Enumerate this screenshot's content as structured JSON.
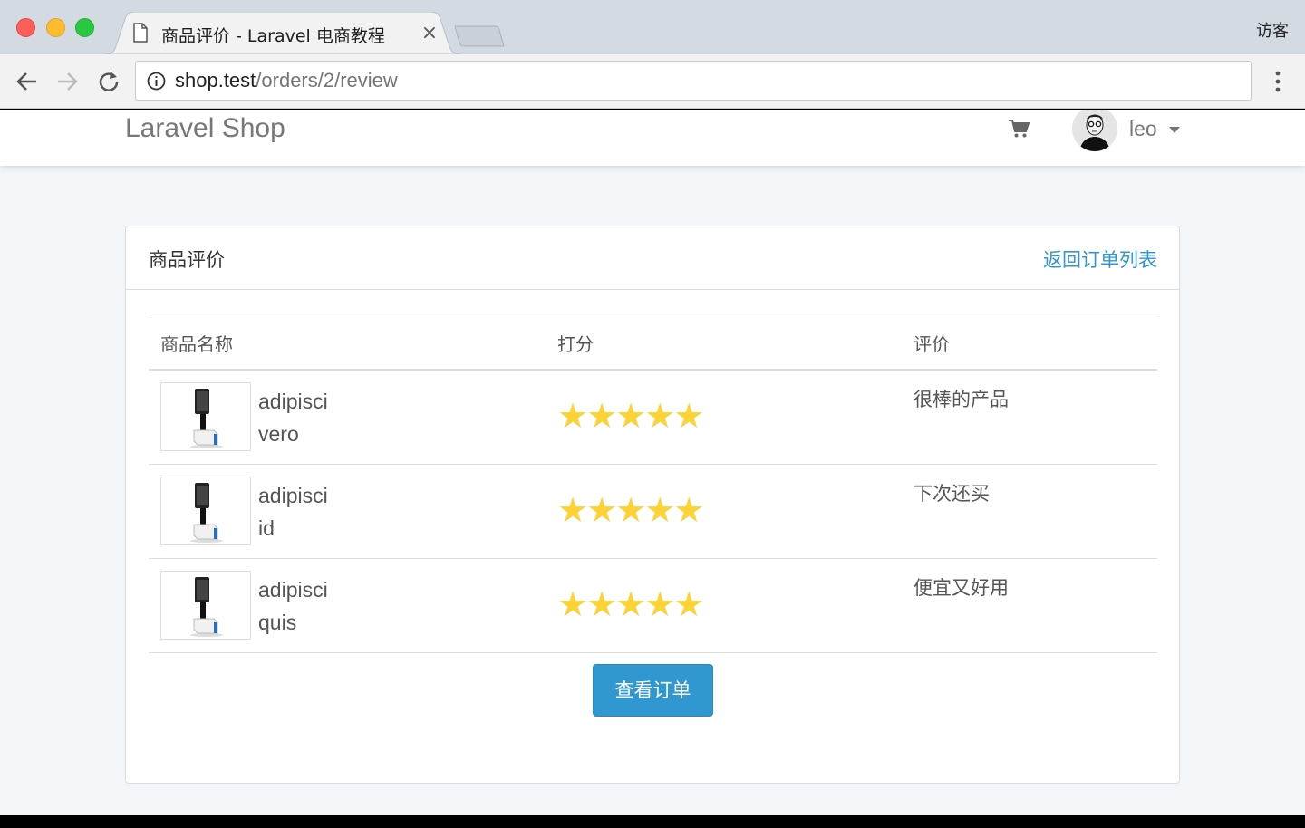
{
  "browser": {
    "tab_title": "商品评价 - Laravel 电商教程",
    "tab_close": "×",
    "guest_label": "访客",
    "url_host": "shop.test",
    "url_path": "/orders/2/review"
  },
  "navbar": {
    "brand": "Laravel Shop",
    "username": "leo",
    "icons": [
      "cart-icon",
      "avatar",
      "caret-down-icon"
    ]
  },
  "panel": {
    "title": "商品评价",
    "back_link": "返回订单列表",
    "columns": [
      "商品名称",
      "打分",
      "评价"
    ],
    "rows": [
      {
        "name": "adipisci",
        "sku": "vero",
        "rating": 5,
        "stars": "★★★★★",
        "review": "很棒的产品"
      },
      {
        "name": "adipisci",
        "sku": "id",
        "rating": 5,
        "stars": "★★★★★",
        "review": "下次还买"
      },
      {
        "name": "adipisci",
        "sku": "quis",
        "rating": 5,
        "stars": "★★★★★",
        "review": "便宜又好用"
      }
    ],
    "view_order_button": "查看订单"
  },
  "colors": {
    "accent": "#3097d1",
    "star": "#fdd235",
    "page_bg": "#f2f6f9"
  }
}
